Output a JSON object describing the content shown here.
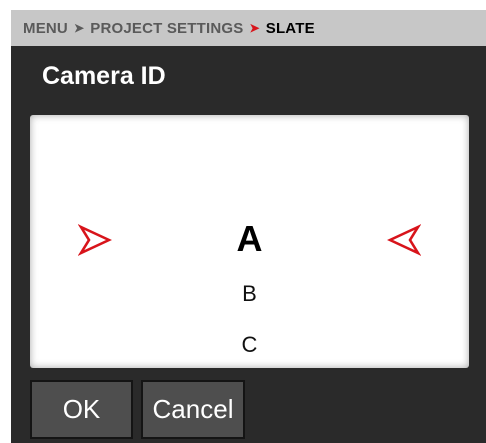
{
  "breadcrumb": {
    "items": [
      "MENU",
      "PROJECT SETTINGS",
      "SLATE"
    ]
  },
  "page": {
    "title": "Camera ID"
  },
  "picker": {
    "selected": "A",
    "options_below": [
      "B",
      "C"
    ],
    "arrow_left_icon": "red-chevron-right-icon",
    "arrow_right_icon": "red-chevron-left-icon",
    "accent_color": "#d8141b"
  },
  "buttons": {
    "ok_label": "OK",
    "cancel_label": "Cancel"
  }
}
